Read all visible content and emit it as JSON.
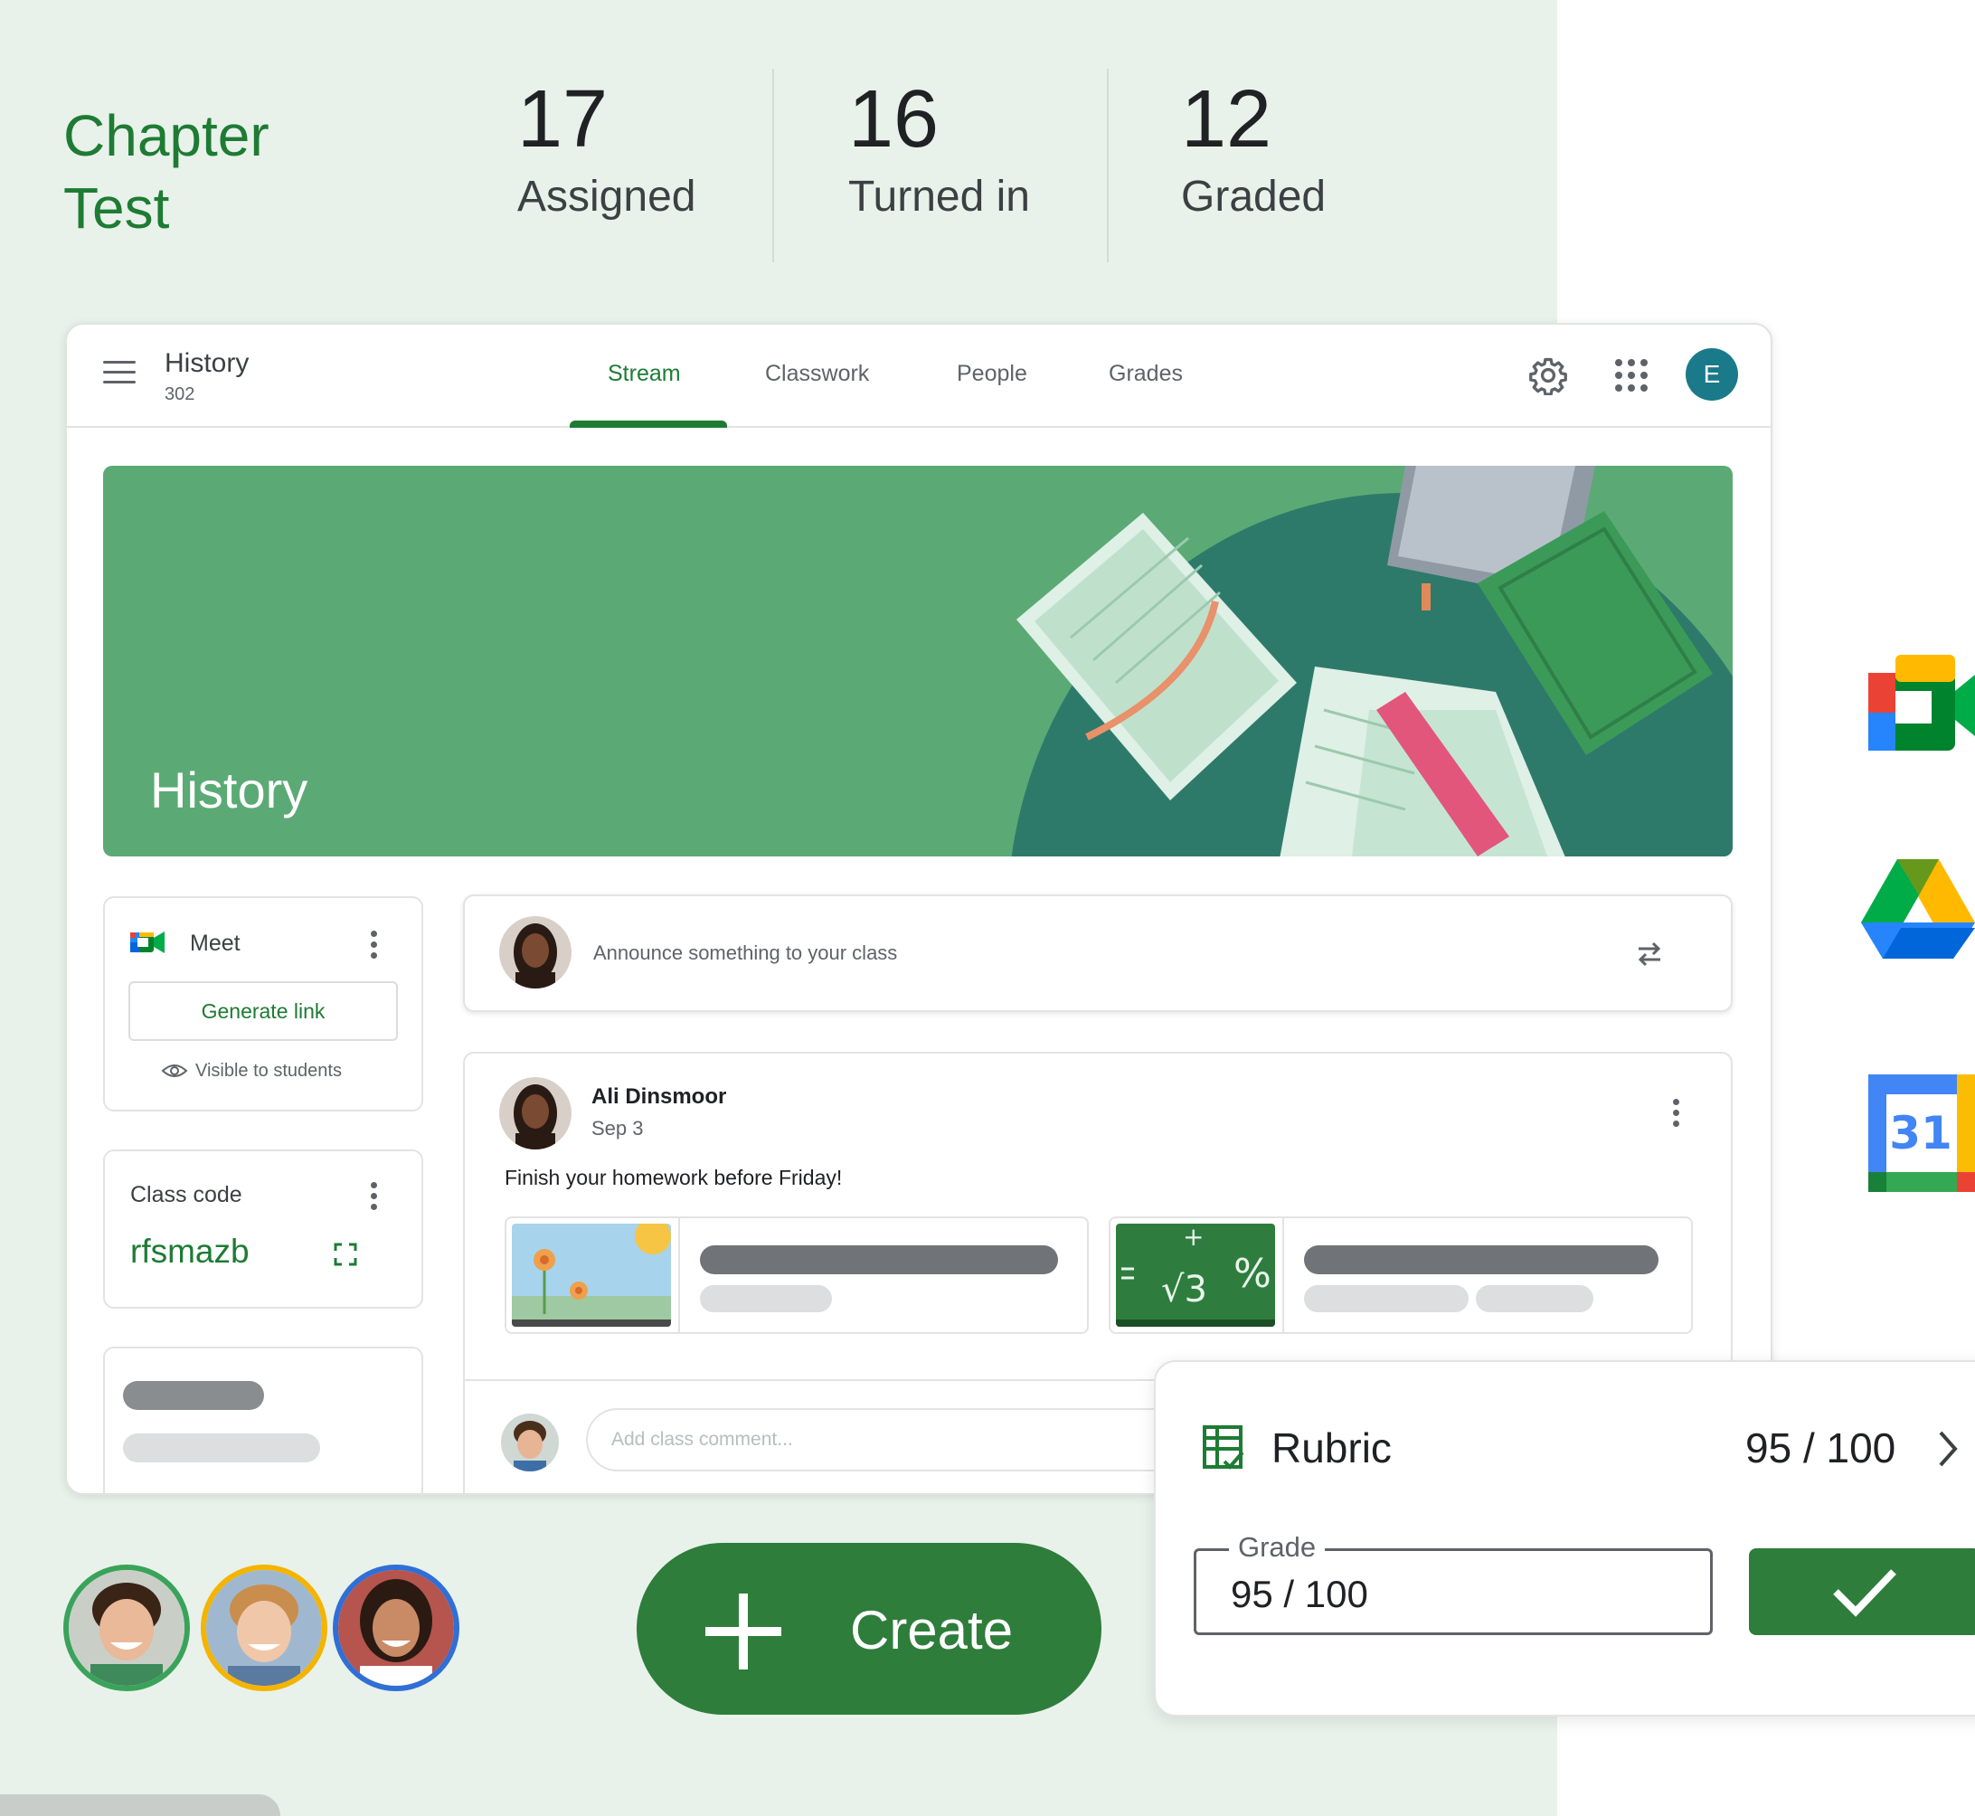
{
  "summary": {
    "title": "Chapter Test",
    "stats": [
      {
        "value": "17",
        "label": "Assigned"
      },
      {
        "value": "16",
        "label": "Turned in"
      },
      {
        "value": "12",
        "label": "Graded"
      }
    ]
  },
  "topbar": {
    "class_name": "History",
    "class_section": "302",
    "tabs": [
      "Stream",
      "Classwork",
      "People",
      "Grades"
    ],
    "active_tab": "Stream",
    "avatar_initial": "E"
  },
  "banner": {
    "title": "History"
  },
  "meet": {
    "label": "Meet",
    "generate_link": "Generate link",
    "visibility": "Visible to students"
  },
  "class_code": {
    "label": "Class code",
    "value": "rfsmazb"
  },
  "announce": {
    "placeholder": "Announce something to your class"
  },
  "post": {
    "author": "Ali Dinsmoor",
    "date": "Sep 3",
    "body": "Finish your homework before Friday!",
    "comment_placeholder": "Add class comment..."
  },
  "rubric": {
    "label": "Rubric",
    "score": "95 / 100",
    "grade_label": "Grade",
    "grade_value": "95 / 100"
  },
  "create": {
    "label": "Create"
  },
  "calendar_icon_text": "31",
  "colors": {
    "brand_green": "#1e7b34",
    "button_green": "#2e7d3b",
    "banner_green": "#5baa75",
    "banner_dark": "#2e7a6a",
    "backdrop": "#e8f2ea"
  },
  "icons": [
    "menu-icon",
    "gear-icon",
    "apps-grid-icon",
    "meet-icon",
    "eye-icon",
    "expand-icon",
    "repost-icon",
    "rubric-icon",
    "chevron-right-icon",
    "check-icon",
    "plus-icon",
    "google-meet-icon",
    "google-drive-icon",
    "google-calendar-icon"
  ]
}
